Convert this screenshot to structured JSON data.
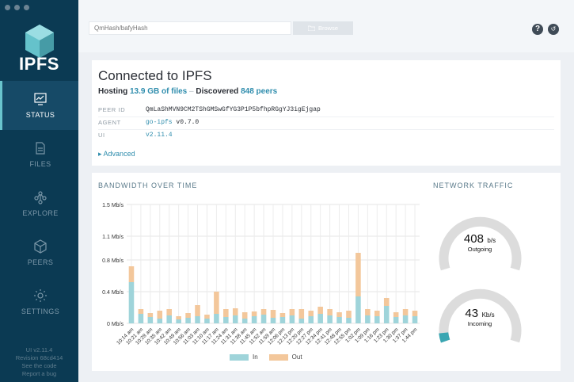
{
  "sidebar": {
    "logo_text": "IPFS",
    "items": [
      {
        "label": "STATUS",
        "active": true,
        "icon": "status-icon"
      },
      {
        "label": "FILES",
        "active": false,
        "icon": "files-icon"
      },
      {
        "label": "EXPLORE",
        "active": false,
        "icon": "explore-icon"
      },
      {
        "label": "PEERS",
        "active": false,
        "icon": "peers-icon"
      },
      {
        "label": "SETTINGS",
        "active": false,
        "icon": "settings-icon"
      }
    ],
    "footer": {
      "ui_version": "UI v2.11.4",
      "revision": "Revision 68cd414",
      "see_code": "See the code",
      "report_bug": "Report a bug"
    }
  },
  "topbar": {
    "search_placeholder": "QmHash/bafyHash",
    "browse_label": "Browse"
  },
  "status": {
    "title": "Connected to IPFS",
    "hosting_prefix": "Hosting",
    "hosting_value": "13.9 GB of files",
    "hosting_sep": " – ",
    "discovered_prefix": "Discovered",
    "discovered_value": "848 peers",
    "peer_id_label": "PEER ID",
    "peer_id_value": "QmLaShMVN9CM2TShGMSwGfYG3P1P5bfhpRGgYJ3igEjgap",
    "agent_label": "AGENT",
    "agent_name": "go-ipfs",
    "agent_version": "v0.7.0",
    "ui_label": "UI",
    "ui_value": "v2.11.4",
    "advanced_label": "Advanced"
  },
  "bandwidth": {
    "title": "BANDWIDTH OVER TIME",
    "legend_in": "In",
    "legend_out": "Out",
    "color_in": "#9fd4da",
    "color_out": "#f3c79b"
  },
  "traffic": {
    "title": "NETWORK TRAFFIC",
    "outgoing_value": "408",
    "outgoing_unit": "b/s",
    "outgoing_label": "Outgoing",
    "outgoing_fraction": 0,
    "incoming_value": "43",
    "incoming_unit": "Kb/s",
    "incoming_label": "Incoming",
    "incoming_fraction": 0.04
  },
  "chart_data": {
    "type": "bar",
    "title": "BANDWIDTH OVER TIME",
    "y_ticks": [
      "0 Mb/s",
      "0.4 Mb/s",
      "0.8 Mb/s",
      "1.1 Mb/s",
      "1.5 Mb/s"
    ],
    "y_tick_values": [
      0,
      0.4,
      0.8,
      1.1,
      1.5
    ],
    "ylim": [
      0,
      1.5
    ],
    "x_ticks": [
      "10:14 am",
      "10:21 am",
      "10:28 am",
      "10:35 am",
      "10:42 am",
      "10:49 am",
      "10:56 am",
      "11:03 am",
      "11:10 am",
      "11:17 am",
      "11:24 am",
      "11:31 am",
      "11:38 am",
      "11:45 am",
      "11:52 am",
      "11:59 am",
      "12:06 pm",
      "12:13 pm",
      "12:20 pm",
      "12:27 pm",
      "12:34 pm",
      "12:41 pm",
      "12:48 pm",
      "12:55 pm",
      "1:02 pm",
      "1:09 pm",
      "1:16 pm",
      "1:23 pm",
      "1:30 pm",
      "1:37 pm",
      "1:44 pm"
    ],
    "stacked": true,
    "series": [
      {
        "name": "In",
        "values": [
          0.52,
          0.12,
          0.08,
          0.06,
          0.1,
          0.05,
          0.07,
          0.09,
          0.06,
          0.12,
          0.08,
          0.1,
          0.06,
          0.09,
          0.11,
          0.07,
          0.08,
          0.1,
          0.06,
          0.09,
          0.12,
          0.1,
          0.08,
          0.07,
          0.34,
          0.1,
          0.09,
          0.22,
          0.08,
          0.1,
          0.09
        ]
      },
      {
        "name": "Out",
        "values": [
          0.2,
          0.06,
          0.05,
          0.1,
          0.08,
          0.04,
          0.06,
          0.14,
          0.05,
          0.28,
          0.1,
          0.09,
          0.08,
          0.06,
          0.07,
          0.1,
          0.05,
          0.08,
          0.12,
          0.07,
          0.09,
          0.08,
          0.06,
          0.09,
          0.55,
          0.08,
          0.07,
          0.1,
          0.06,
          0.08,
          0.07
        ]
      }
    ],
    "grid": true,
    "legend": "bottom-center"
  }
}
